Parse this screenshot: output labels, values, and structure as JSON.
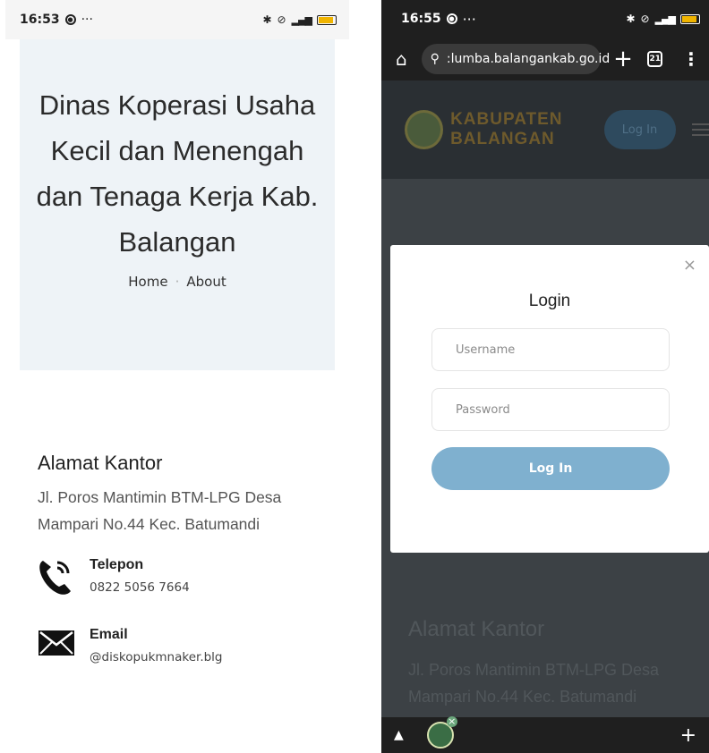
{
  "left": {
    "status": {
      "time": "16:53",
      "extra": "···"
    },
    "hero": {
      "title": "Dinas Koperasi Usaha Kecil dan Menengah dan Tenaga Kerja Kab. Balangan",
      "breadcrumb": [
        "Home",
        "About"
      ]
    },
    "contact": {
      "heading": "Alamat Kantor",
      "address": "Jl. Poros Mantimin BTM-LPG Desa Mampari No.44 Kec. Batumandi",
      "phone_label": "Telepon",
      "phone_value": "0822 5056 7664",
      "email_label": "Email",
      "email_value": "@diskopukmnaker.blg"
    }
  },
  "right": {
    "status": {
      "time": "16:55",
      "extra": "···"
    },
    "browser": {
      "url": ":lumba.balangankab.go.id",
      "tab_count": "21"
    },
    "header": {
      "site_name_1": "KABUPATEN",
      "site_name_2": "BALANGAN",
      "login_label": "Log In"
    },
    "modal": {
      "title": "Login",
      "username_placeholder": "Username",
      "password_placeholder": "Password",
      "submit_label": "Log In",
      "close_glyph": "×"
    },
    "background": {
      "heading": "Alamat Kantor",
      "address": "Jl. Poros Mantimin BTM-LPG Desa Mampari No.44 Kec. Batumandi"
    }
  },
  "colors": {
    "hero_bg": "#eef3f7",
    "modal_button": "#7fb0cf",
    "overlay_dim": "#3c4145"
  }
}
